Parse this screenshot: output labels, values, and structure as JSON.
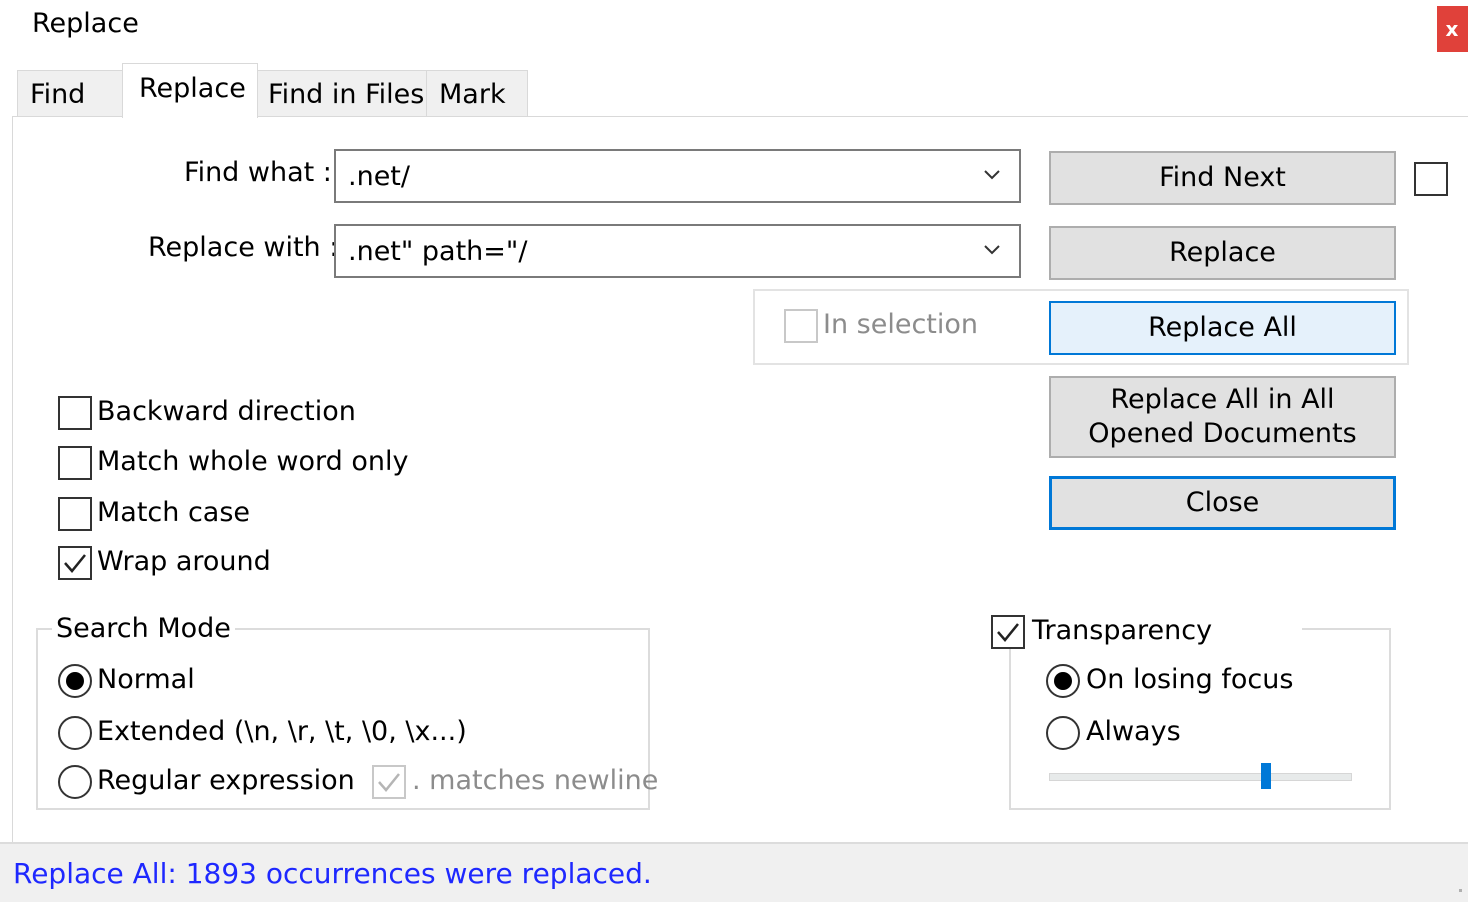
{
  "window": {
    "title": "Replace",
    "close_glyph": "x"
  },
  "tabs": [
    {
      "label": "Find",
      "active": false
    },
    {
      "label": "Replace",
      "active": true
    },
    {
      "label": "Find in Files",
      "active": false
    },
    {
      "label": "Mark",
      "active": false
    }
  ],
  "form": {
    "find_label": "Find what :",
    "find_value": ".net/",
    "replace_label": "Replace with :",
    "replace_value": ".net\" path=\"/"
  },
  "buttons": {
    "find_next": "Find Next",
    "replace": "Replace",
    "replace_all": "Replace All",
    "replace_all_docs": "Replace All in All Opened Documents",
    "close": "Close"
  },
  "in_selection": {
    "label": "In selection",
    "checked": false,
    "enabled": false
  },
  "options": [
    {
      "label": "Backward direction",
      "checked": false
    },
    {
      "label": "Match whole word only",
      "checked": false
    },
    {
      "label": "Match case",
      "checked": false
    },
    {
      "label": "Wrap around",
      "checked": true
    }
  ],
  "search_mode": {
    "title": "Search Mode",
    "modes": [
      {
        "label": "Normal",
        "selected": true
      },
      {
        "label": "Extended (\\n, \\r, \\t, \\0, \\x...)",
        "selected": false
      },
      {
        "label": "Regular expression",
        "selected": false
      }
    ],
    "matches_newline": {
      "label": ". matches newline",
      "checked": true,
      "enabled": false
    }
  },
  "transparency": {
    "label": "Transparency",
    "checked": true,
    "modes": [
      {
        "label": "On losing focus",
        "selected": true
      },
      {
        "label": "Always",
        "selected": false
      }
    ],
    "slider_fraction": 0.7
  },
  "status": {
    "text": "Replace All: 1893 occurrences were replaced.",
    "color": "#1e28ff"
  },
  "colors": {
    "accent": "#0078d7",
    "close_bg": "#e0413a"
  }
}
